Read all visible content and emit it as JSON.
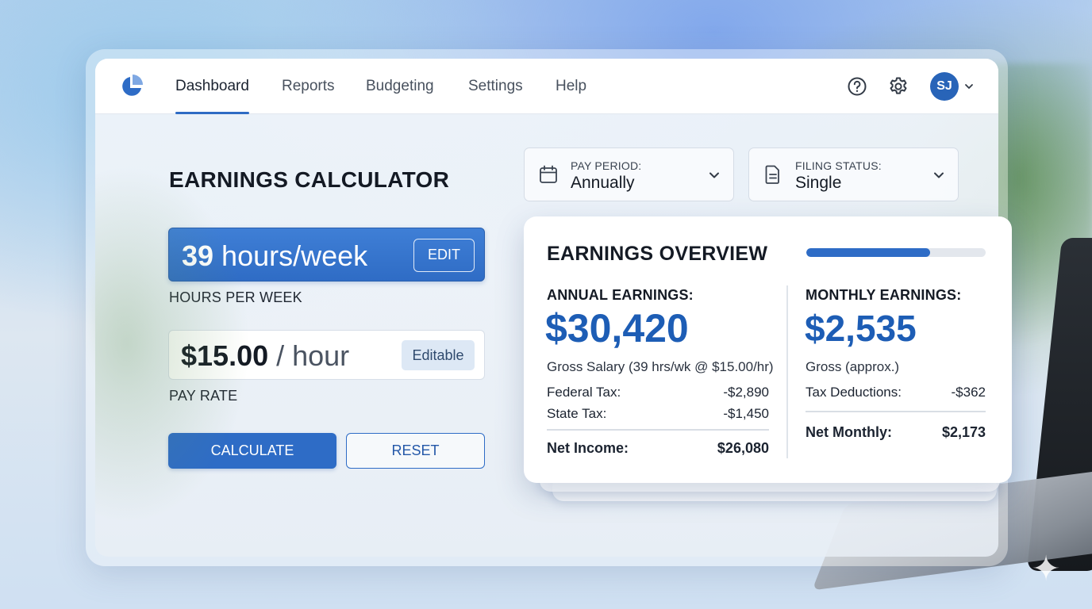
{
  "nav": {
    "items": [
      {
        "label": "Dashboard",
        "active": true
      },
      {
        "label": "Reports",
        "active": false
      },
      {
        "label": "Budgeting",
        "active": false
      },
      {
        "label": "Settings",
        "active": false
      },
      {
        "label": "Help",
        "active": false
      }
    ],
    "icons": [
      "pie-logo-icon",
      "help-icon",
      "gear-icon",
      "chevron-down-icon"
    ],
    "avatar_initials": "SJ"
  },
  "calculator": {
    "title": "EARNINGS CALCULATOR",
    "hours": {
      "number": "39",
      "unit": " hours/week",
      "edit_label": "EDIT",
      "field_label": "HOURS PER WEEK"
    },
    "rate": {
      "amount": "$15.00",
      "unit": " / hour",
      "tag": "Editable",
      "field_label": "PAY RATE"
    },
    "calculate_label": "CALCULATE",
    "reset_label": "RESET"
  },
  "filters": {
    "pay_period": {
      "label": "PAY PERIOD:",
      "value": "Annually",
      "icon": "calendar-icon"
    },
    "filing_status": {
      "label": "FILING STATUS:",
      "value": "Single",
      "icon": "document-icon"
    }
  },
  "overview": {
    "title": "EARNINGS OVERVIEW",
    "progress": 0.69,
    "annual": {
      "label": "ANNUAL EARNINGS:",
      "value": "$30,420",
      "sub": "Gross Salary (39 hrs/wk @ $15.00/hr)",
      "rows": [
        {
          "label": "Federal Tax:",
          "value": "-$2,890"
        },
        {
          "label": "State Tax:",
          "value": "-$1,450"
        }
      ],
      "total": {
        "label": "Net Income:",
        "value": "$26,080"
      }
    },
    "monthly": {
      "label": "MONTHLY EARNINGS:",
      "value": "$2,535",
      "sub": "Gross (approx.)",
      "rows": [
        {
          "label": "Tax Deductions:",
          "value": "-$362"
        }
      ],
      "total": {
        "label": "Net Monthly:",
        "value": "$2,173"
      }
    }
  },
  "colors": {
    "accent": "#2e6cc6",
    "value_blue": "#1d5db5",
    "avatar": "#2864b8"
  }
}
